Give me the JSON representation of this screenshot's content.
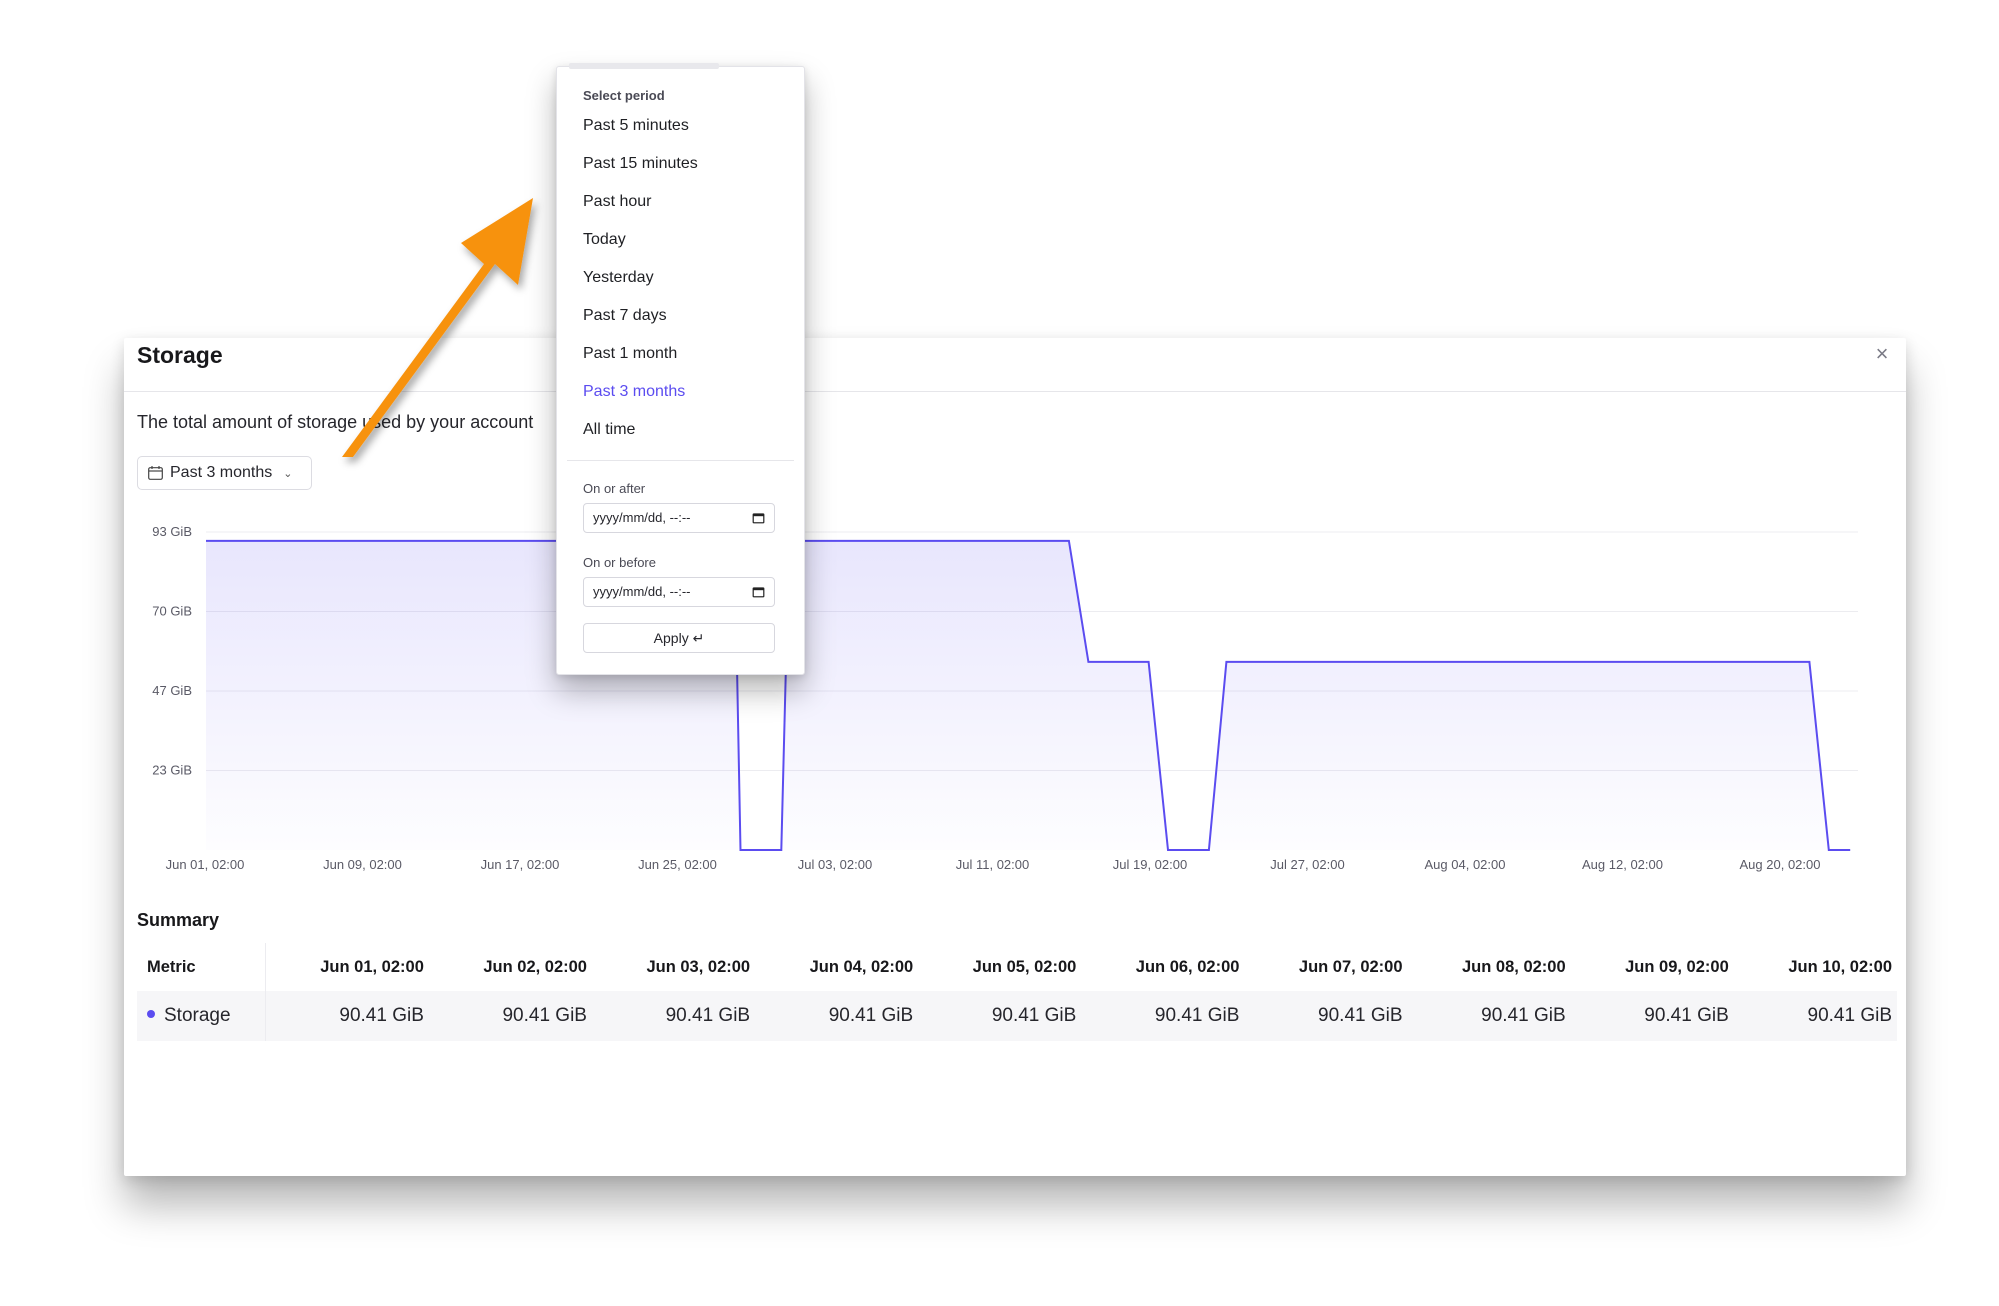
{
  "modal": {
    "title": "Storage",
    "close_symbol": "×",
    "description": "The total amount of storage used by your account",
    "period_button_label": "Past 3 months"
  },
  "chart_data": {
    "type": "area",
    "y_ticks": [
      "93 GiB",
      "70 GiB",
      "47 GiB",
      "23 GiB"
    ],
    "ylim": [
      0,
      93
    ],
    "x_ticks": [
      "Jun 01, 02:00",
      "Jun 09, 02:00",
      "Jun 17, 02:00",
      "Jun 25, 02:00",
      "Jul 03, 02:00",
      "Jul 11, 02:00",
      "Jul 19, 02:00",
      "Jul 27, 02:00",
      "Aug 04, 02:00",
      "Aug 12, 02:00",
      "Aug 20, 02:00"
    ],
    "grid": true,
    "color": "#5b4cf0",
    "series": [
      {
        "values": [
          {
            "x": 0,
            "y": 90.41
          },
          {
            "x": 27.2,
            "y": 90.41
          },
          {
            "x": 27.5,
            "y": 0
          },
          {
            "x": 29.6,
            "y": 0
          },
          {
            "x": 30,
            "y": 90.41
          },
          {
            "x": 44.4,
            "y": 90.41
          },
          {
            "x": 45.4,
            "y": 55
          },
          {
            "x": 48.5,
            "y": 55
          },
          {
            "x": 49.5,
            "y": 0
          },
          {
            "x": 51.6,
            "y": 0
          },
          {
            "x": 52.5,
            "y": 55
          },
          {
            "x": 82.5,
            "y": 55
          },
          {
            "x": 83.5,
            "y": 0
          },
          {
            "x": 84.6,
            "y": 0
          }
        ]
      }
    ]
  },
  "summary": {
    "title": "Summary",
    "metric_header": "Metric",
    "columns": [
      "Jun 01, 02:00",
      "Jun 02, 02:00",
      "Jun 03, 02:00",
      "Jun 04, 02:00",
      "Jun 05, 02:00",
      "Jun 06, 02:00",
      "Jun 07, 02:00",
      "Jun 08, 02:00",
      "Jun 09, 02:00",
      "Jun 10, 02:00"
    ],
    "rows": [
      {
        "metric": "Storage",
        "color": "#5b4cf0",
        "values": [
          "90.41 GiB",
          "90.41 GiB",
          "90.41 GiB",
          "90.41 GiB",
          "90.41 GiB",
          "90.41 GiB",
          "90.41 GiB",
          "90.41 GiB",
          "90.41 GiB",
          "90.41 GiB"
        ]
      }
    ]
  },
  "dropdown": {
    "title": "Select period",
    "options": [
      "Past 5 minutes",
      "Past 15 minutes",
      "Past hour",
      "Today",
      "Yesterday",
      "Past 7 days",
      "Past 1 month",
      "Past 3 months",
      "All time"
    ],
    "selected_option": "Past 3 months",
    "on_or_after_label": "On or after",
    "on_or_before_label": "On or before",
    "date_placeholder": "yyyy/mm/dd, --:--",
    "apply_label": "Apply ↵"
  },
  "annotation": {
    "arrow_color": "#f7920f"
  }
}
